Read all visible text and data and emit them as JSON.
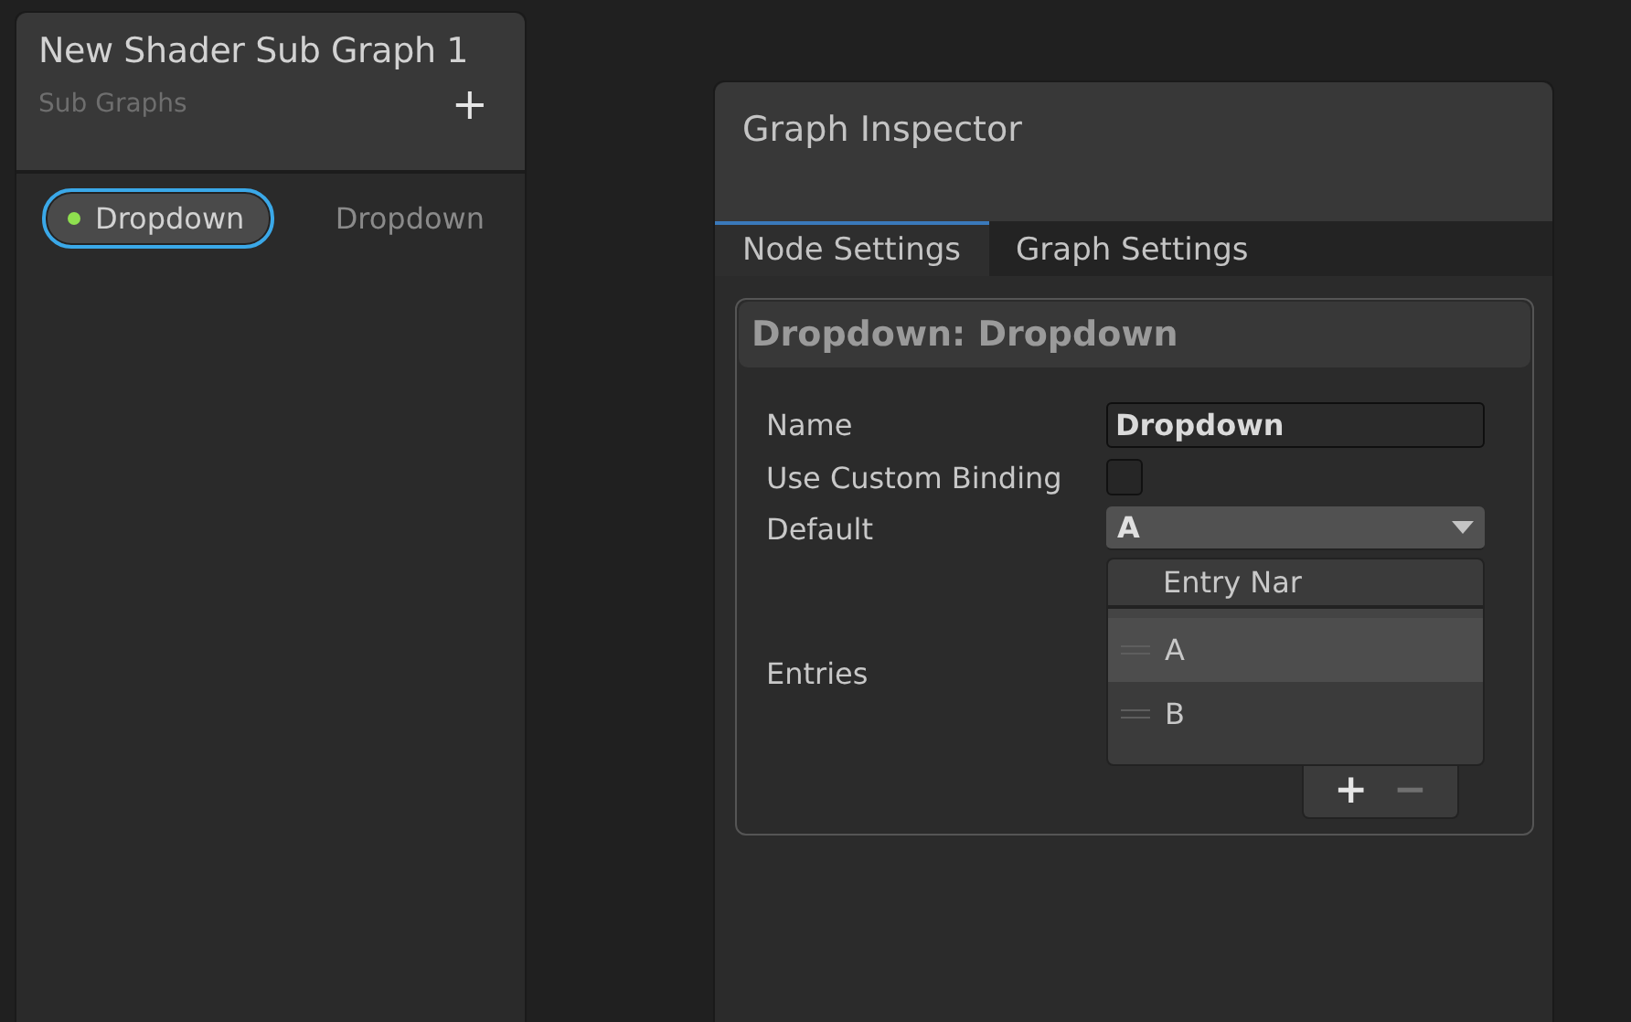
{
  "blackboard": {
    "title": "New Shader Sub Graph 1",
    "subtitle": "Sub Graphs",
    "add_label": "+",
    "properties": [
      {
        "name": "Dropdown",
        "type": "Dropdown",
        "selected": true,
        "color": "#8fe04f"
      }
    ]
  },
  "inspector": {
    "title": "Graph Inspector",
    "tabs": [
      {
        "label": "Node Settings",
        "selected": true
      },
      {
        "label": "Graph Settings",
        "selected": false
      }
    ],
    "section_title": "Dropdown: Dropdown",
    "fields": [
      {
        "kind": "text",
        "label": "Name",
        "value": "Dropdown"
      },
      {
        "kind": "checkbox",
        "label": "Use Custom Binding",
        "checked": false
      },
      {
        "kind": "dropdown",
        "label": "Default",
        "value": "A"
      },
      {
        "kind": "list",
        "label": "Entries",
        "header": "Entry Nar",
        "items": [
          {
            "label": "A",
            "selected": true
          },
          {
            "label": "B",
            "selected": false
          }
        ],
        "add_label": "+",
        "remove_label": "−",
        "remove_disabled": true
      }
    ]
  }
}
